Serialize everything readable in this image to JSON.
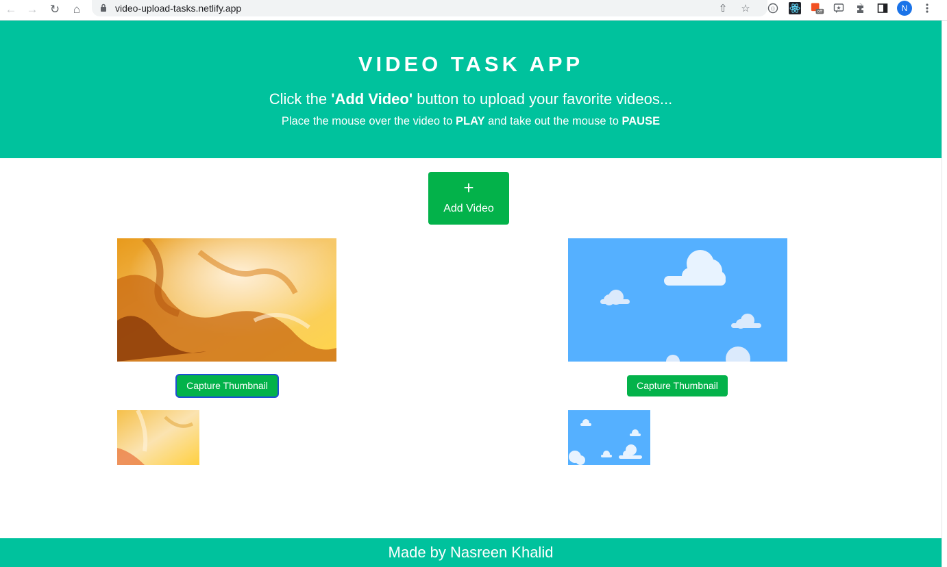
{
  "browser": {
    "url": "video-upload-tasks.netlify.app",
    "profile_initial": "N",
    "extension_badge": "off",
    "icons": [
      "back-icon",
      "forward-icon",
      "reload-icon",
      "home-icon",
      "lock-icon",
      "share-icon",
      "bookmark-star-icon",
      "extensions-icon",
      "side-panel-icon",
      "menu-icon"
    ]
  },
  "hero": {
    "title": "VIDEO TASK APP",
    "sub_prefix": "Click the ",
    "sub_bold": "'Add Video'",
    "sub_suffix": " button to upload your favorite videos...",
    "hint_prefix": "Place the mouse over the video to ",
    "hint_play": "PLAY",
    "hint_middle": " and take out the mouse to ",
    "hint_pause": "PAUSE"
  },
  "add_button": {
    "icon": "+",
    "label": "Add Video"
  },
  "videos": [
    {
      "capture_label": "Capture Thumbnail",
      "scene": "golden-texture"
    },
    {
      "capture_label": "Capture Thumbnail",
      "scene": "blue-sky-clouds"
    }
  ],
  "footer": {
    "text": "Made by Nasreen Khalid"
  },
  "colors": {
    "brand": "#00c29d",
    "button": "#03b24a",
    "focus_ring": "#1e4fd4"
  }
}
